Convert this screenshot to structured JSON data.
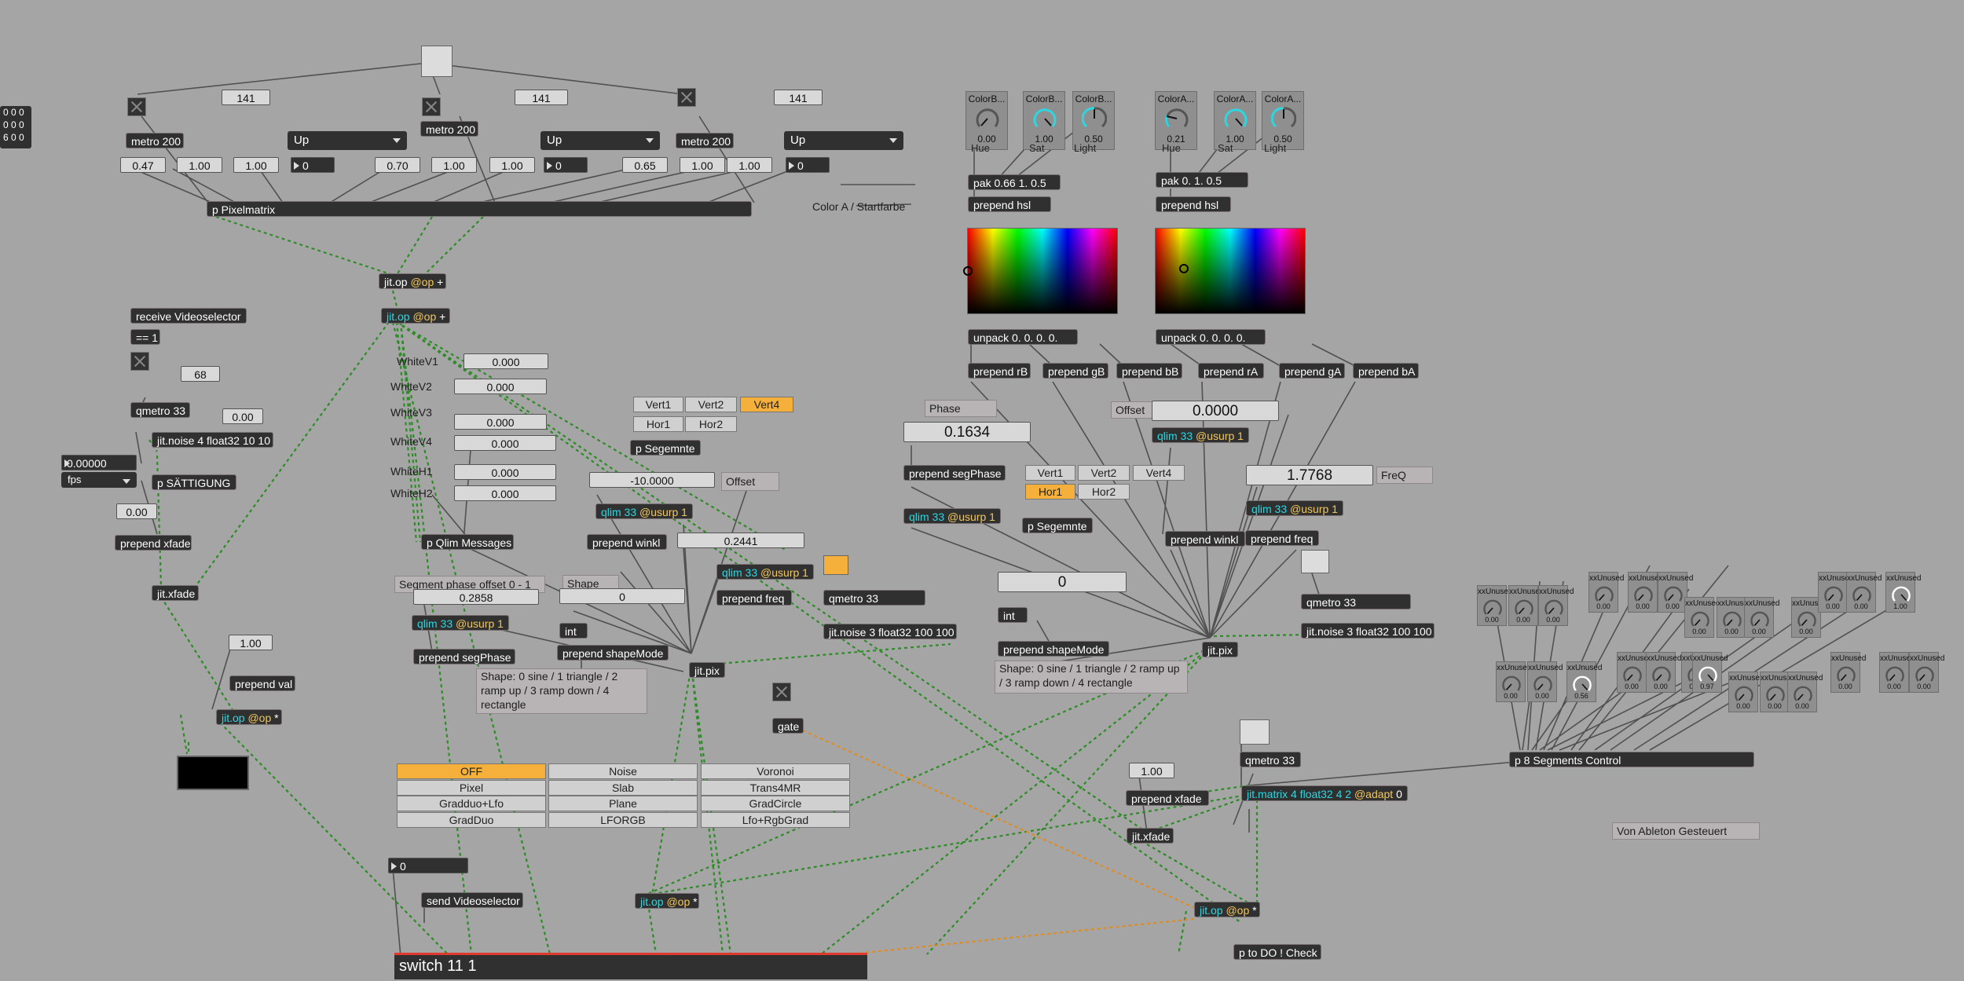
{
  "colors": {
    "canvas": "#a5a5a5",
    "object": "#303030",
    "cable_green": "#4aa63b",
    "cable_orange": "#e08c1f",
    "accent": "#f4b03a",
    "switch_border": "#e0392d"
  },
  "top": {
    "nums": [
      "141",
      "141",
      "141"
    ],
    "metros": [
      "metro 200",
      "metro 200",
      "metro 200"
    ],
    "menus": [
      "Up",
      "Up",
      "Up"
    ],
    "dkvals": [
      "0",
      "0",
      "0"
    ],
    "vals": [
      "0.47",
      "1.00",
      "1.00",
      "0.70",
      "1.00",
      "1.00",
      "0.65",
      "1.00",
      "1.00"
    ],
    "pixelmatrix": "p Pixelmatrix",
    "matrix_lines": [
      "0 0 0",
      "0 0 0",
      "6 0 0"
    ]
  },
  "center": {
    "jitop1_a": "jit.op",
    "jitop1_b": "@op",
    "jitop1_c": "+",
    "jitop2_a": "jit.op",
    "jitop2_b": "@op",
    "jitop2_c": "+",
    "white_labels": [
      "WhiteV1",
      "WhiteV2",
      "WhiteV3",
      "WhiteV4",
      "WhiteH1",
      "WhiteH2"
    ],
    "white_vals": [
      "0.000",
      "0.000",
      "0.000",
      "0.000",
      "0.000",
      "0.000"
    ],
    "qlim_messages": "p Qlim Messages"
  },
  "left": {
    "receive": "receive Videoselector",
    "eq": "== 1",
    "num68": "68",
    "qmetro": "qmetro 33",
    "v000": "0.00",
    "noise": "jit.noise 4 float32 10 10",
    "fps_val": "0.00000",
    "fps_unit": "fps",
    "sattigung": "p SÄTTIGUNG",
    "v000b": "0.00",
    "prepend_xfade": "prepend xfade",
    "xfade": "jit.xfade",
    "v100": "1.00",
    "prepend_val": "prepend val",
    "jitop_a": "jit.op",
    "jitop_b": "@op",
    "jitop_c": "*"
  },
  "seg": {
    "tabs": [
      "Vert1",
      "Vert2",
      "Vert4",
      "Hor1",
      "Hor2"
    ],
    "p_seg": "p Segemnte",
    "offset_val": "-10.0000",
    "offset_label": "Offset",
    "qlim_a": "qlim 33",
    "qlim_b": "@usurp 1",
    "prepend_winkl": "prepend winkl",
    "val_2441": "0.2441",
    "qlim2_a": "qlim 33",
    "qlim2_b": "@usurp 1",
    "prepend_freq": "prepend freq",
    "qmetro": "qmetro 33",
    "noise": "jit.noise 3 float32 100 100",
    "phase_label": "Segment phase offset 0 - 1",
    "shape_label": "Shape",
    "phase_val": "0.2858",
    "shape_val": "0",
    "qlim3_a": "qlim 33",
    "qlim3_b": "@usurp 1",
    "int": "int",
    "prepend_shape": "prepend shapeMode",
    "prepend_seg": "prepend segPhase",
    "jitpix": "jit.pix",
    "shape_comment": "Shape: 0 sine / 1 triangle / 2 ramp up / 3 ramp down / 4 rectangle",
    "gate": "gate"
  },
  "grid": {
    "buttons": [
      "OFF",
      "Noise",
      "Voronoi",
      "Pixel",
      "Slab",
      "Trans4MR",
      "Gradduo+Lfo",
      "Plane",
      "GradCircle",
      "GradDuo",
      "LFORGB",
      "Lfo+RgbGrad"
    ],
    "num0": "0",
    "send": "send Videoselector",
    "jitop_a": "jit.op",
    "jitop_b": "@op",
    "jitop_c": "*",
    "switch": "switch 11 1"
  },
  "colorB": {
    "dials": [
      {
        "title": "ColorB...",
        "val": "0.00",
        "label": "Hue"
      },
      {
        "title": "ColorB...",
        "val": "1.00",
        "label": "Sat"
      },
      {
        "title": "ColorB...",
        "val": "0.50",
        "label": "Light"
      }
    ],
    "pak": "pak 0.66 1. 0.5",
    "prepend_hsl": "prepend hsl",
    "unpack": "unpack 0. 0. 0. 0.",
    "prepends": [
      "prepend rB",
      "prepend gB",
      "prepend bB"
    ]
  },
  "colorA": {
    "dials": [
      {
        "title": "ColorA...",
        "val": "0.21",
        "label": "Hue"
      },
      {
        "title": "ColorA...",
        "val": "1.00",
        "label": "Sat"
      },
      {
        "title": "ColorA...",
        "val": "0.50",
        "label": "Light"
      }
    ],
    "pak": "pak 0. 1. 0.5",
    "prepend_hsl": "prepend hsl",
    "unpack": "unpack 0. 0. 0. 0.",
    "prepends": [
      "prepend rA",
      "prepend gA",
      "prepend bA"
    ],
    "comment": "Color A / Startfarbe"
  },
  "right": {
    "phase_label": "Phase",
    "phase_val": "0.1634",
    "prepend_seg": "prepend segPhase",
    "qlim_a": "qlim 33",
    "qlim_b": "@usurp 1",
    "offset_label": "Offset",
    "offset_val": "0.0000",
    "qlim2_a": "qlim 33",
    "qlim2_b": "@usurp 1",
    "tabs": [
      "Vert1",
      "Vert2",
      "Vert4",
      "Hor1",
      "Hor2"
    ],
    "p_seg": "p Segemnte",
    "freq_val": "1.7768",
    "freq_label": "FreQ",
    "qlim3_a": "qlim 33",
    "qlim3_b": "@usurp 1",
    "prepend_winkl": "prepend winkl",
    "prepend_freq": "prepend freq",
    "shape_val": "0",
    "int": "int",
    "prepend_shape": "prepend shapeMode",
    "shape_comment": "Shape: 0 sine / 1 triangle / 2 ramp up / 3 ramp down / 4 rectangle",
    "jitpix": "jit.pix",
    "qmetro": "qmetro 33",
    "noise": "jit.noise 3 float32 100 100",
    "qmetro2": "qmetro 33",
    "v100": "1.00",
    "prepend_xfade": "prepend xfade",
    "matrix_a": "jit.matrix 4 float32 4 2",
    "matrix_b": "@adapt",
    "matrix_c": "0",
    "xfade": "jit.xfade",
    "jitop_a": "jit.op",
    "jitop_b": "@op",
    "jitop_c": "*",
    "todo": "p to DO ! Check",
    "segments": "p 8 Segments Control",
    "ableton": "Von Ableton Gesteuert"
  },
  "unused": {
    "top": [
      {
        "t": "xxUnused",
        "v": "0.00"
      },
      {
        "t": "xxUnused",
        "v": "0.00"
      },
      {
        "t": "xxUnused",
        "v": "0.00"
      },
      {
        "t": "xxUnused",
        "v": "0.00"
      },
      {
        "t": "xxUnused",
        "v": "0.00"
      },
      {
        "t": "xxUnused",
        "v": "0.00"
      },
      {
        "t": "xxUnused",
        "v": "0.00"
      },
      {
        "t": "xxUnused",
        "v": "0.00"
      },
      {
        "t": "xxUnused",
        "v": "0.00"
      },
      {
        "t": "xxUnused",
        "v": "0.00"
      },
      {
        "t": "xxUnused",
        "v": "0.00"
      },
      {
        "t": "xxUnused",
        "v": "0.00"
      },
      {
        "t": "xxUnused",
        "v": "1.00"
      }
    ],
    "bottom": [
      {
        "t": "xxUnused",
        "v": "0.00"
      },
      {
        "t": "xxUnused",
        "v": "0.00"
      },
      {
        "t": "xxUnused",
        "v": "0.56"
      },
      {
        "t": "xxUnused",
        "v": "0.00"
      },
      {
        "t": "xxUnused",
        "v": "0.00"
      },
      {
        "t": "xxUnused",
        "v": "0.00"
      },
      {
        "t": "xxUnused",
        "v": "0.97"
      },
      {
        "t": "xxUnused",
        "v": "0.00"
      },
      {
        "t": "xxUnused",
        "v": "0.00"
      },
      {
        "t": "xxUnused",
        "v": "0.00"
      },
      {
        "t": "xxUnused",
        "v": "0.00"
      },
      {
        "t": "xxUnused",
        "v": "0.00"
      },
      {
        "t": "xxUnused",
        "v": "0.00"
      }
    ]
  }
}
